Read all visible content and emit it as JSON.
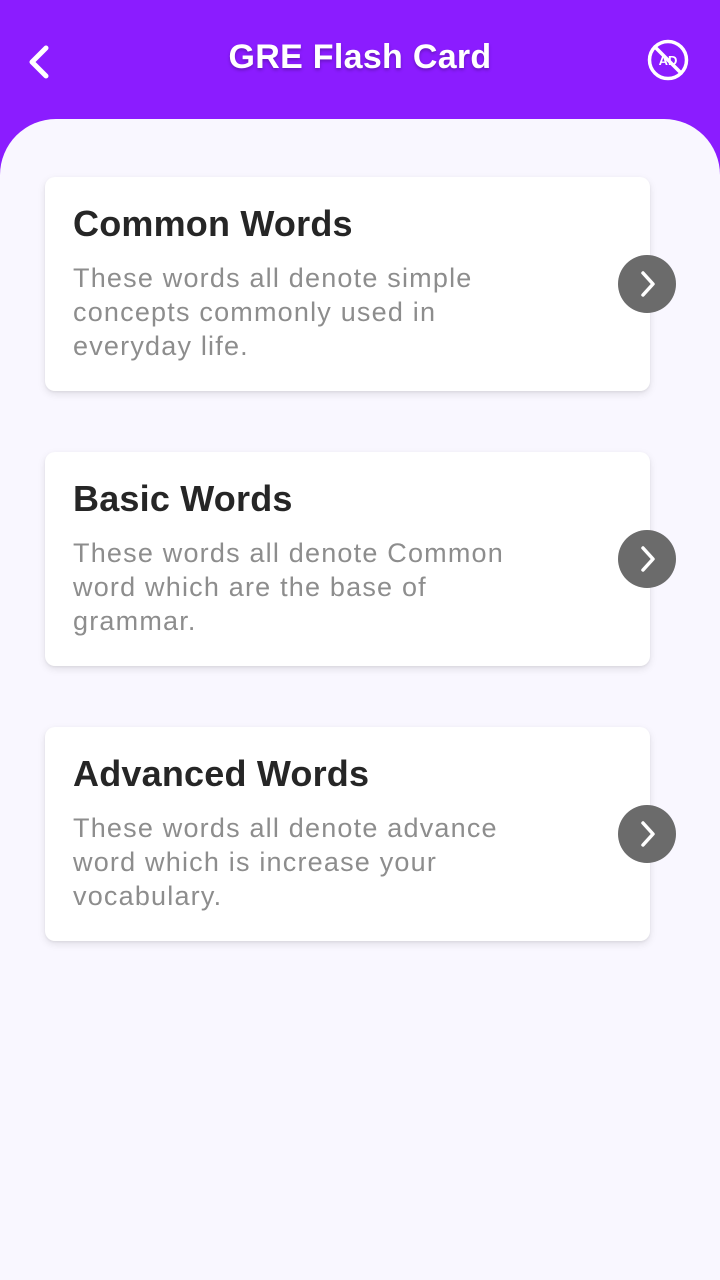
{
  "app": {
    "title": "GRE Flash Card",
    "accent_color": "#8b1cff",
    "icons": {
      "back": "chevron-left-icon",
      "no_ads": "no-ads-icon",
      "open": "chevron-right-icon"
    }
  },
  "categories": [
    {
      "title": "Common Words",
      "description": "These words all denote simple concepts commonly used in everyday life."
    },
    {
      "title": "Basic Words",
      "description": "These words all denote Common word which are the base of grammar."
    },
    {
      "title": "Advanced Words",
      "description": "These words all denote advance word which is increase your vocabulary."
    }
  ]
}
